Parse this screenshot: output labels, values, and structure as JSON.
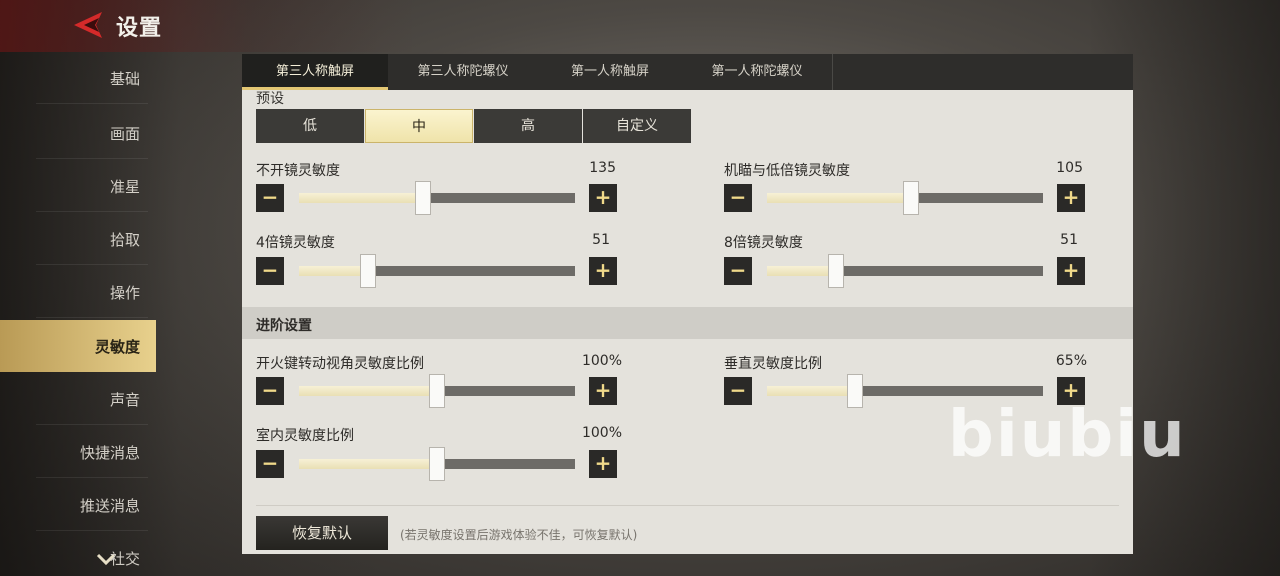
{
  "header": {
    "title": "设置"
  },
  "sidebar": {
    "items": [
      {
        "label": "基础"
      },
      {
        "label": "画面"
      },
      {
        "label": "准星"
      },
      {
        "label": "拾取"
      },
      {
        "label": "操作"
      },
      {
        "label": "灵敏度"
      },
      {
        "label": "声音"
      },
      {
        "label": "快捷消息"
      },
      {
        "label": "推送消息"
      },
      {
        "label": "社交"
      }
    ],
    "active_index": 5
  },
  "tabs": [
    {
      "label": "第三人称触屏"
    },
    {
      "label": "第三人称陀螺仪"
    },
    {
      "label": "第一人称触屏"
    },
    {
      "label": "第一人称陀螺仪"
    }
  ],
  "preset": {
    "label": "预设",
    "options": [
      "低",
      "中",
      "高",
      "自定义"
    ],
    "selected": "中"
  },
  "sliders": {
    "no_scope": {
      "label": "不开镜灵敏度",
      "value": "135",
      "level": 0.45
    },
    "red_dot": {
      "label": "机瞄与低倍镜灵敏度",
      "value": "105",
      "level": 0.52
    },
    "scope4x": {
      "label": "4倍镜灵敏度",
      "value": "51",
      "level": 0.25
    },
    "scope8x": {
      "label": "8倍镜灵敏度",
      "value": "51",
      "level": 0.25
    }
  },
  "advanced": {
    "title": "进阶设置",
    "fire_ratio": {
      "label": "开火键转动视角灵敏度比例",
      "value": "100%",
      "level": 0.5
    },
    "vertical_ratio": {
      "label": "垂直灵敏度比例",
      "value": "65%",
      "level": 0.32
    },
    "indoor_ratio": {
      "label": "室内灵敏度比例",
      "value": "100%",
      "level": 0.5
    }
  },
  "footer": {
    "reset_label": "恢复默认",
    "hint": "(若灵敏度设置后游戏体验不佳，可恢复默认)"
  },
  "watermark": "biubiu",
  "colors": {
    "accent": "#e3c774",
    "active_side": "#d8bf78",
    "panel_bg": "#e4e2dc",
    "dark_btn": "#2a2927"
  }
}
